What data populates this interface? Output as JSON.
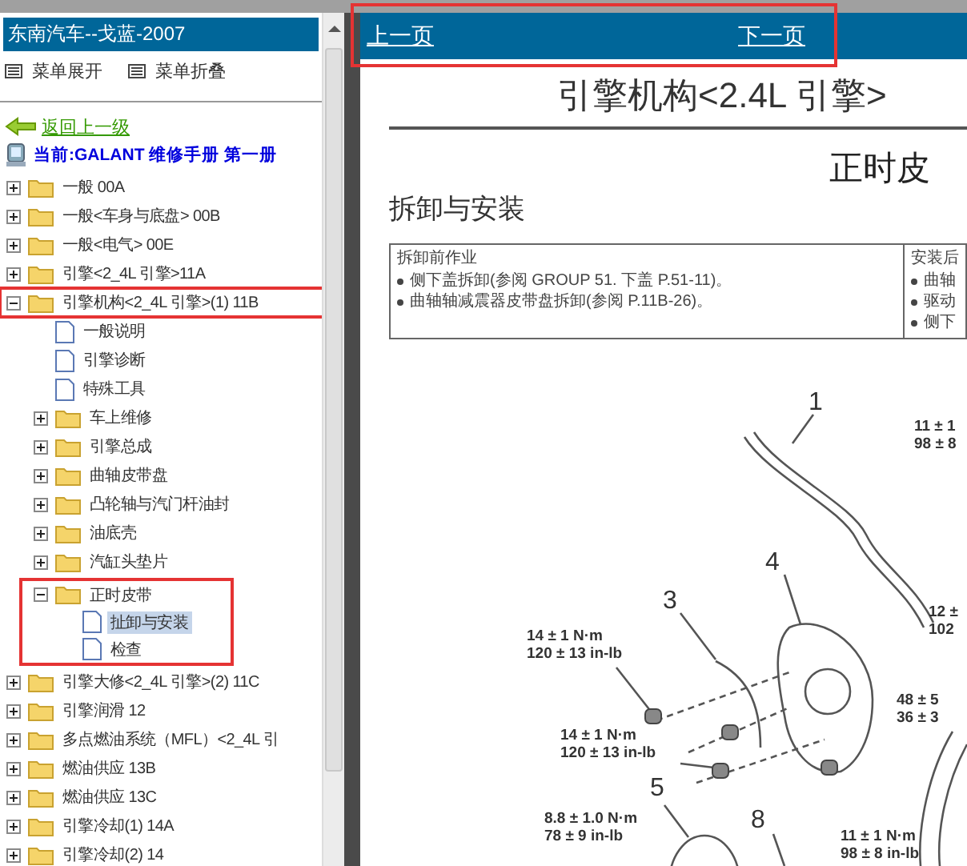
{
  "sidebar": {
    "title": "东南汽车--戈蓝-2007",
    "menu_actions": [
      "菜单展开",
      "菜单折叠"
    ],
    "back_link": "返回上一级",
    "current": "当前:GALANT 维修手册 第一册",
    "tree": [
      {
        "label": "一般 00A",
        "kind": "folder",
        "expanded": false,
        "selected": false
      },
      {
        "label": "一般<车身与底盘> 00B",
        "kind": "folder",
        "expanded": false,
        "selected": false
      },
      {
        "label": "一般<电气> 00E",
        "kind": "folder",
        "expanded": false,
        "selected": false
      },
      {
        "label": "引擎<2_4L 引擎>11A",
        "kind": "folder",
        "expanded": false,
        "selected": false
      },
      {
        "label": "引擎机构<2_4L 引擎>(1) 11B",
        "kind": "folder",
        "expanded": true,
        "selected": false,
        "children": [
          {
            "label": "一般说明",
            "kind": "page",
            "selected": false
          },
          {
            "label": "引擎诊断",
            "kind": "page",
            "selected": false
          },
          {
            "label": "特殊工具",
            "kind": "page",
            "selected": false
          },
          {
            "label": "车上维修",
            "kind": "folder",
            "expanded": false,
            "selected": false
          },
          {
            "label": "引擎总成",
            "kind": "folder",
            "expanded": false,
            "selected": false
          },
          {
            "label": "曲轴皮带盘",
            "kind": "folder",
            "expanded": false,
            "selected": false
          },
          {
            "label": "凸轮轴与汽门杆油封",
            "kind": "folder",
            "expanded": false,
            "selected": false
          },
          {
            "label": "油底壳",
            "kind": "folder",
            "expanded": false,
            "selected": false
          },
          {
            "label": "汽缸头垫片",
            "kind": "folder",
            "expanded": false,
            "selected": false
          },
          {
            "label": "正时皮带",
            "kind": "folder",
            "expanded": true,
            "selected": false,
            "children": [
              {
                "label": "扯卸与安装",
                "kind": "page",
                "selected": true
              },
              {
                "label": "检查",
                "kind": "page",
                "selected": false
              }
            ]
          }
        ]
      },
      {
        "label": "引擎大修<2_4L 引擎>(2) 11C",
        "kind": "folder",
        "expanded": false,
        "selected": false
      },
      {
        "label": "引擎润滑 12",
        "kind": "folder",
        "expanded": false,
        "selected": false
      },
      {
        "label": "多点燃油系统（MFL）<2_4L 引",
        "kind": "folder",
        "expanded": false,
        "selected": false
      },
      {
        "label": "燃油供应 13B",
        "kind": "folder",
        "expanded": false,
        "selected": false
      },
      {
        "label": "燃油供应 13C",
        "kind": "folder",
        "expanded": false,
        "selected": false
      },
      {
        "label": "引擎冷却(1) 14A",
        "kind": "folder",
        "expanded": false,
        "selected": false
      },
      {
        "label": "引擎冷却(2) 14",
        "kind": "folder",
        "expanded": false,
        "selected": false
      }
    ]
  },
  "nav": {
    "prev": "上一页",
    "next": "下一页"
  },
  "document": {
    "title": "引擎机构<2.4L 引擎>",
    "section": "正时皮",
    "heading": "拆卸与安装",
    "before_work": {
      "title": "拆卸前作业",
      "items": [
        "侧下盖拆卸(参阅 GROUP 51. 下盖 P.51-11)。",
        "曲轴轴减震器皮带盘拆卸(参阅 P.11B-26)。"
      ]
    },
    "after_work": {
      "title": "安装后",
      "items": [
        "曲轴",
        "驱动",
        "侧下"
      ]
    },
    "callouts": [
      {
        "text": "1"
      },
      {
        "text": "11 ± 1\n98 ± 8"
      },
      {
        "text": "4"
      },
      {
        "text": "3"
      },
      {
        "text": "14 ± 1 N·m\n120 ± 13 in-lb"
      },
      {
        "text": "12 ±\n102"
      },
      {
        "text": "14 ± 1 N·m\n120 ± 13 in-lb"
      },
      {
        "text": "48 ± 5\n36 ± 3"
      },
      {
        "text": "5"
      },
      {
        "text": "8.8 ± 1.0 N·m\n78 ± 9 in-lb"
      },
      {
        "text": "8"
      },
      {
        "text": "11 ± 1 N·m\n98 ± 8 in-lb"
      }
    ]
  }
}
